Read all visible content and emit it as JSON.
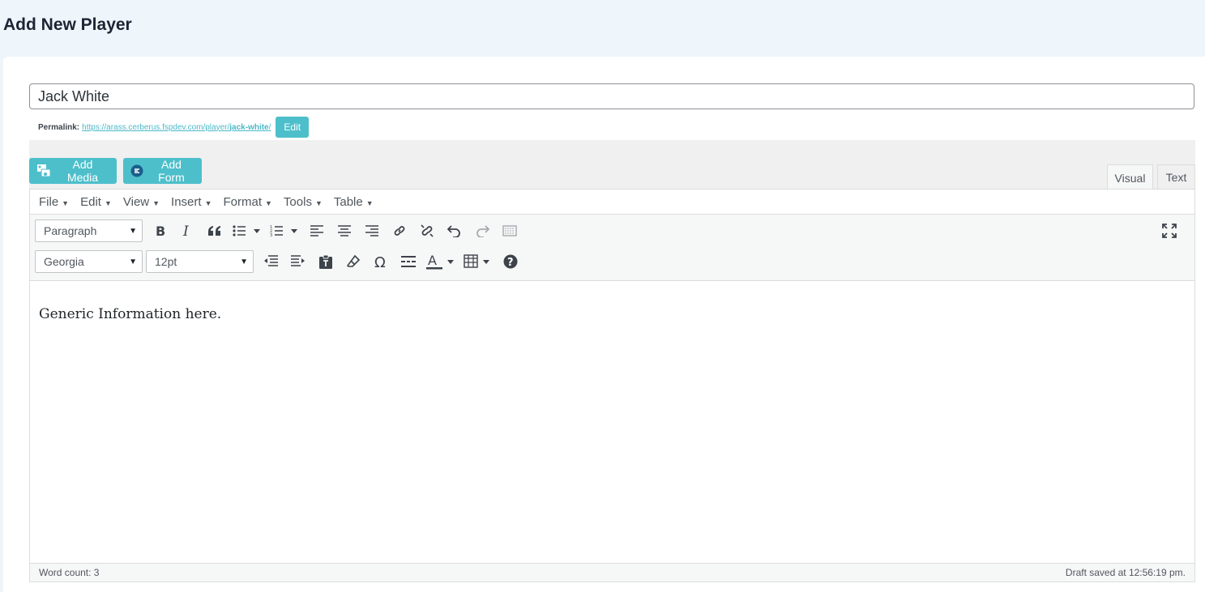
{
  "page": {
    "title": "Add New Player"
  },
  "title_field": {
    "value": "Jack White"
  },
  "permalink": {
    "label": "Permalink:",
    "url_base": "https://arass.cerberus.fspdev.com/player/",
    "slug": "jack-white",
    "url_suffix": "/",
    "edit_label": "Edit"
  },
  "media_buttons": {
    "add_media": "Add Media",
    "add_form": "Add Form"
  },
  "editor_tabs": {
    "visual": "Visual",
    "text": "Text",
    "active": "visual"
  },
  "menubar": [
    "File",
    "Edit",
    "View",
    "Insert",
    "Format",
    "Tools",
    "Table"
  ],
  "toolbar": {
    "format_select": "Paragraph",
    "font_select": "Georgia",
    "size_select": "12pt",
    "row1_icons": [
      "bold-icon",
      "italic-icon",
      "blockquote-icon",
      "bullet-list-icon",
      "numbered-list-icon",
      "align-left-icon",
      "align-center-icon",
      "align-right-icon",
      "link-icon",
      "unlink-icon",
      "undo-icon",
      "redo-icon",
      "read-more-icon",
      "fullscreen-icon"
    ],
    "row2_icons": [
      "outdent-icon",
      "indent-icon",
      "paste-text-icon",
      "clear-formatting-icon",
      "special-character-icon",
      "horizontal-line-icon",
      "text-color-icon",
      "table-icon",
      "help-icon"
    ]
  },
  "content": {
    "text": "Generic Information here."
  },
  "status": {
    "word_count": "Word count: 3",
    "draft_saved": "Draft saved at 12:56:19 pm."
  }
}
